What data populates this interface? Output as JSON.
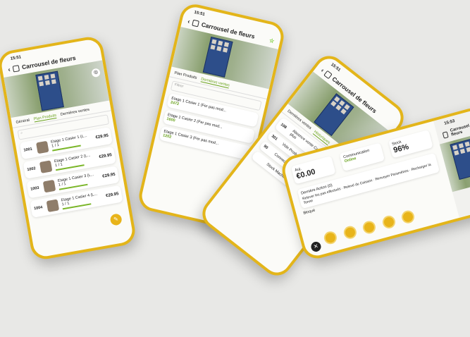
{
  "app": {
    "title": "Carrousel de fleurs",
    "time": "15:51",
    "time2": "15:53"
  },
  "tabs": [
    "Général",
    "Plan Produits",
    "Dernières ventes",
    "Historiques"
  ],
  "products": [
    {
      "num": "1001",
      "name": "Etage 1 Casier 1 (L...",
      "qty": "1 / 1",
      "price": "€29.95"
    },
    {
      "num": "1002",
      "name": "Etage 1 Casier 2 (L...",
      "qty": "1 / 1",
      "price": "€29.95"
    },
    {
      "num": "1003",
      "name": "Etage 1 Casier 3 (L...",
      "qty": "1 / 1",
      "price": "€29.95"
    },
    {
      "num": "1004",
      "name": "Etage 1 Casier 4 (L...",
      "qty": "1 / 1",
      "price": "€29.95"
    }
  ],
  "sales": [
    {
      "name": "Etage 1 Casier 1 (Fer pas mod...",
      "value": "2472"
    },
    {
      "name": "Etage 1 Casier 2 (Fer pas mod...",
      "value": "1600"
    },
    {
      "name": "Etage 1 Casier 3 (Fer pas mod...",
      "value": "1202"
    }
  ],
  "events": [
    {
      "code": "108",
      "text": "Absence vente Carte bancaire depuis plus"
    },
    {
      "code": "301",
      "text": "Vide Produit"
    },
    {
      "code": "90",
      "text": "Connection Établie avec le serveur"
    },
    {
      "code": "",
      "text": "Stock Machine"
    }
  ],
  "dashboard": {
    "today_label": "Auj.",
    "today_value": "€0.00",
    "comm_label": "Communication",
    "comm_status": "Online",
    "stock_label": "Stock",
    "stock_value": "96%",
    "actions_label": "Dernière Action (0)",
    "buttons": [
      "Relever les pas effectués",
      "Relevé du Caisson",
      "Renvoyer Paramètres",
      "Recharger la Tonne"
    ],
    "bottom_label": "Bloqué"
  },
  "filter_label": "Filtrer"
}
